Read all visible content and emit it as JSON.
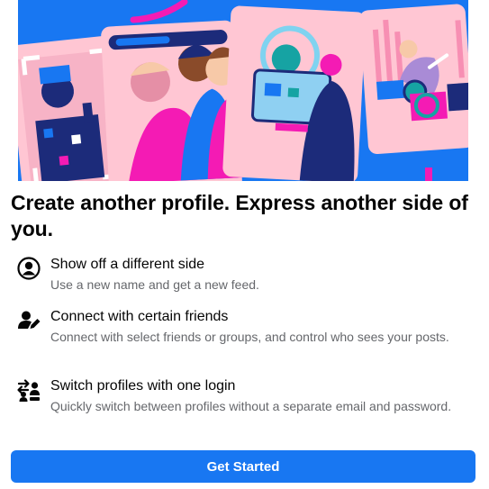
{
  "hero": {
    "illustration": "profiles-illustration",
    "colors": {
      "background": "#1877f2",
      "card": "#ffc6d3",
      "accent": "#f41bb4",
      "navy": "#1c2b7a",
      "teal": "#16a3a3"
    }
  },
  "title": "Create another profile. Express another side of you.",
  "features": [
    {
      "icon": "person-circle-icon",
      "title": "Show off a different side",
      "description": "Use a new name and get a new feed."
    },
    {
      "icon": "person-edit-icon",
      "title": "Connect with certain friends",
      "description": "Connect with select friends or groups, and control who sees your posts."
    },
    {
      "icon": "switch-profiles-icon",
      "title": "Switch profiles with one login",
      "description": "Quickly switch between profiles without a separate email and password."
    }
  ],
  "cta": {
    "label": "Get Started",
    "color": "#1877f2"
  }
}
